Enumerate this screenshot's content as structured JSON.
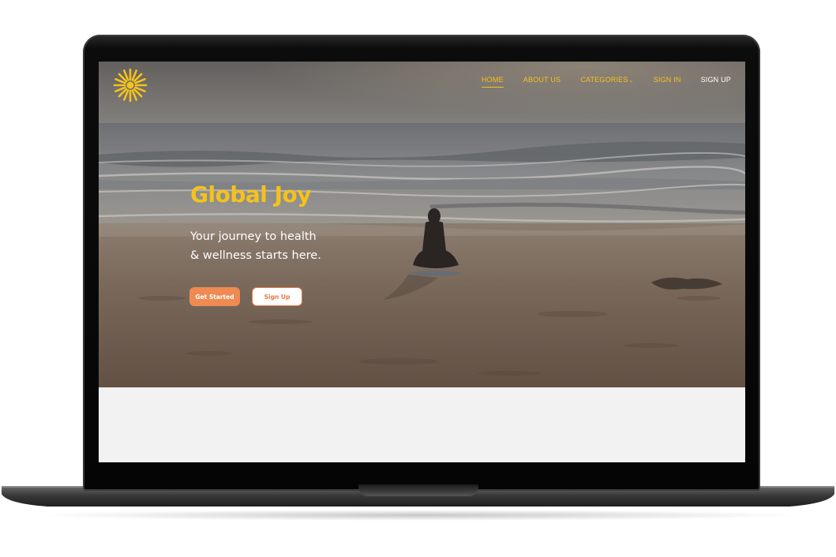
{
  "site": {
    "logo_icon": "sun-logo-icon",
    "brand_color": "#f5c21b",
    "accent_color": "#ee8a52"
  },
  "nav": {
    "items": [
      {
        "label": "HOME",
        "active": true
      },
      {
        "label": "ABOUT US"
      },
      {
        "label": "CATEGORIES",
        "icon": "chevron-down-icon"
      },
      {
        "label": "SIGN IN"
      },
      {
        "label": "SIGN UP"
      }
    ]
  },
  "hero": {
    "title": "Global Joy",
    "subtitle_line1": "Your journey to health",
    "subtitle_line2": "& wellness starts here.",
    "primary_button": "Get Started",
    "secondary_button": "Sign Up"
  }
}
